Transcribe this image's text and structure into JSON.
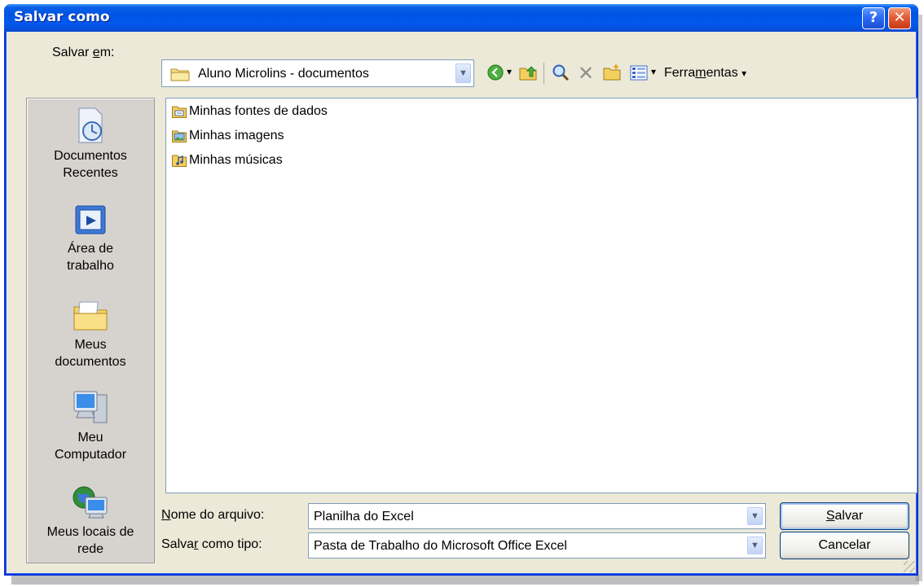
{
  "window": {
    "title": "Salvar como",
    "help_glyph": "?",
    "close_glyph": "✕"
  },
  "lookin": {
    "label_pre": "Salvar ",
    "label_key": "e",
    "label_post": "m:",
    "value": "Aluno Microlins - documentos"
  },
  "toolbar": {
    "tools_pre": "Ferra",
    "tools_key": "m",
    "tools_post": "entas",
    "dropdown_glyph": "▾",
    "delete_glyph": "✕"
  },
  "places": {
    "recent": "Documentos Recentes",
    "desktop": "Área de trabalho",
    "mydocs": "Meus documentos",
    "mycomputer": "Meu Computador",
    "network": "Meus locais de rede"
  },
  "files": [
    {
      "name": "Minhas fontes de dados",
      "icon": "data-sources-folder-icon"
    },
    {
      "name": "Minhas imagens",
      "icon": "pictures-folder-icon"
    },
    {
      "name": "Minhas músicas",
      "icon": "music-folder-icon"
    }
  ],
  "filename": {
    "label_key": "N",
    "label_rest": "ome do arquivo:",
    "value": "Planilha do Excel"
  },
  "filetype": {
    "label_pre": "Salva",
    "label_key": "r",
    "label_post": " como tipo:",
    "value": "Pasta de Trabalho do Microsoft Office Excel"
  },
  "buttons": {
    "save_key": "S",
    "save_rest": "alvar",
    "cancel": "Cancelar"
  },
  "colors": {
    "title_bar": "#0054e3",
    "dialog_bg": "#ece9d8",
    "places_bg": "#d6d3ce",
    "field_border": "#7f9db9"
  }
}
